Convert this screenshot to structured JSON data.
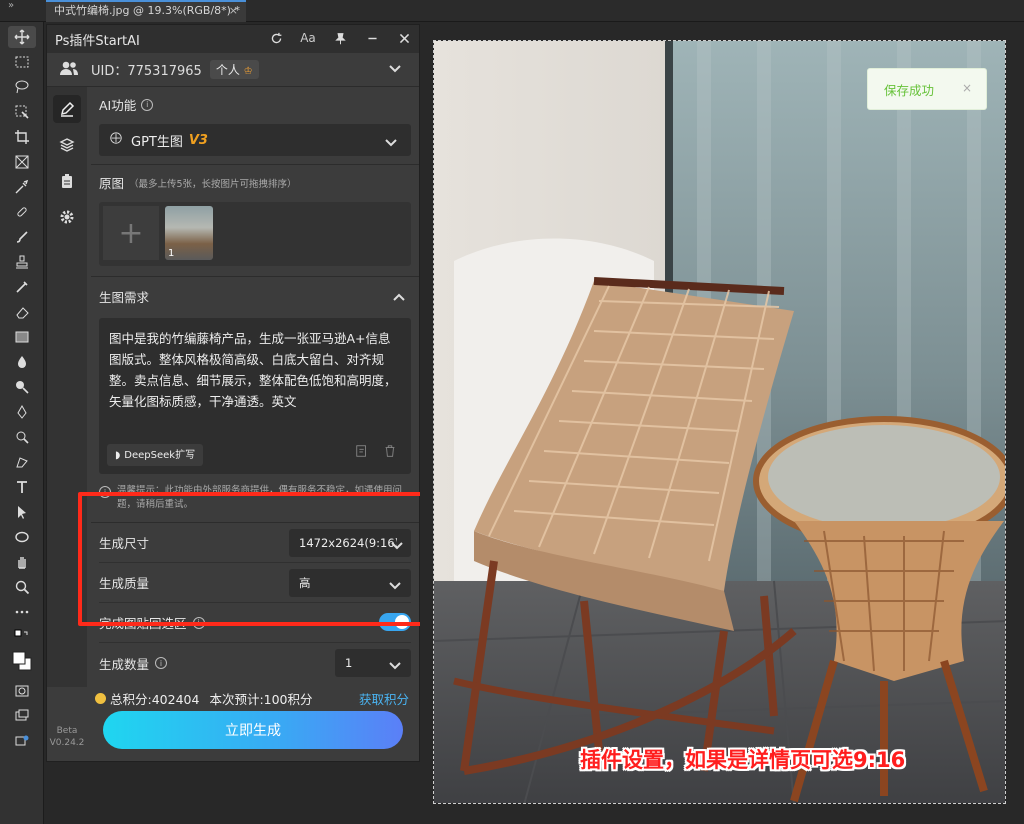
{
  "app": {
    "collapse_glyph": "»",
    "doc_tab": "中式竹编椅.jpg @ 19.3%(RGB/8*) *",
    "doc_tab_close": "×"
  },
  "plugin": {
    "title": "Ps插件StartAI",
    "text_icon": "Aa",
    "uid_label": "UID：775317965",
    "account_tag": "个人",
    "ai_function_label": "AI功能",
    "model_name": "GPT生图",
    "model_version": "V3",
    "source_label": "原图",
    "source_hint": "（最多上传5张，长按图片可拖拽排序）",
    "thumb_count": "1",
    "prompt_section_label": "生图需求",
    "prompt_text": "图中是我的竹编藤椅产品，生成一张亚马逊A+信息图版式。整体风格极简高级、白底大留白、对齐规整。卖点信息、细节展示，整体配色低饱和高明度，矢量化图标质感，干净通透。英文",
    "deepseek_label": "DeepSeek扩写",
    "notice": "温馨提示：此功能由外部服务商提供，偶有服务不稳定，如遇使用问题，请稍后重试。",
    "size_label": "生成尺寸",
    "size_value": "1472x2624(9:16)",
    "quality_label": "生成质量",
    "quality_value": "高",
    "paste_back_label": "完成图贴回选区",
    "paste_back_on": true,
    "count_label": "生成数量",
    "count_value": "1",
    "total_points": "总积分:402404",
    "estimate": "本次预计:100积分",
    "get_points": "获取积分",
    "generate_button": "立即生成",
    "beta_label": "Beta",
    "version": "V0.24.2"
  },
  "canvas": {
    "toast_text": "保存成功",
    "toast_close": "×",
    "caption": "插件设置，如果是详情页可选9:16"
  },
  "colors": {
    "accent": "#38a6f0",
    "highlight_box": "#ff2a1a",
    "caption": "#ff1e1e",
    "toast_text": "#67c23a"
  }
}
